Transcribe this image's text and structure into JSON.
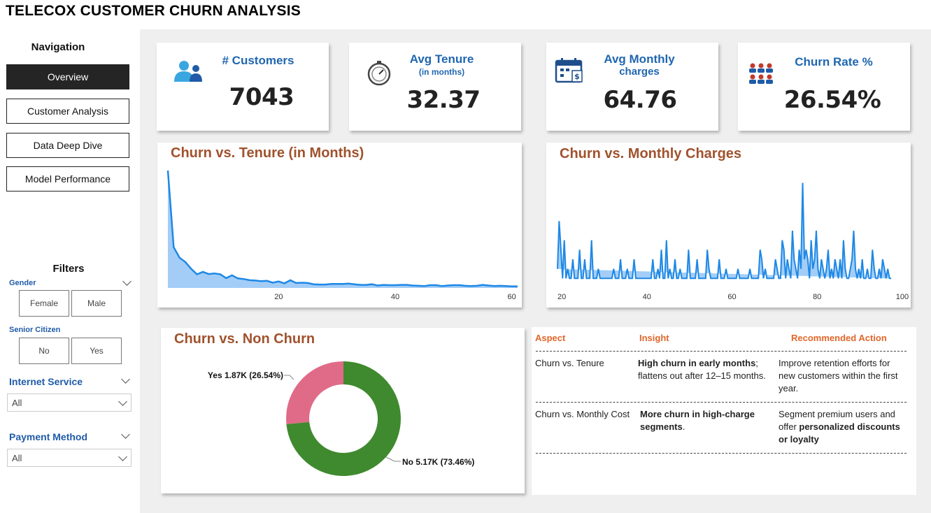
{
  "page": {
    "title": "TELECOX CUSTOMER CHURN ANALYSIS"
  },
  "sidebar": {
    "nav_title": "Navigation",
    "nav_items": [
      {
        "label": "Overview",
        "active": true
      },
      {
        "label": "Customer Analysis",
        "active": false
      },
      {
        "label": "Data Deep Dive",
        "active": false
      },
      {
        "label": "Model Performance",
        "active": false
      }
    ],
    "filters_title": "Filters",
    "gender": {
      "label": "Gender",
      "options": [
        "Female",
        "Male"
      ]
    },
    "senior": {
      "label": "Senior Citizen",
      "options": [
        "No",
        "Yes"
      ]
    },
    "internet": {
      "label": "Internet Service",
      "value": "All"
    },
    "payment": {
      "label": "Payment Method",
      "value": "All"
    }
  },
  "kpis": [
    {
      "label": "# Customers",
      "sub": "",
      "value": "7043",
      "icon": "customers-icon"
    },
    {
      "label": "Avg Tenure",
      "sub": "(in months)",
      "value": "32.37",
      "icon": "stopwatch-icon"
    },
    {
      "label": "Avg Monthly",
      "sub": "charges",
      "value": "64.76",
      "icon": "calendar-dollar-icon"
    },
    {
      "label": "Churn Rate %",
      "sub": "",
      "value": "26.54%",
      "icon": "people-group-icon"
    }
  ],
  "chart_data": [
    {
      "type": "area",
      "title": "Churn vs. Tenure (in Months)",
      "xlabel": "",
      "ylabel": "",
      "xlim": [
        1,
        61
      ],
      "x_ticks": [
        20,
        40,
        60
      ],
      "x": [
        1,
        2,
        3,
        4,
        5,
        6,
        7,
        8,
        9,
        10,
        11,
        12,
        13,
        14,
        15,
        16,
        17,
        18,
        19,
        20,
        21,
        22,
        23,
        24,
        25,
        26,
        27,
        28,
        29,
        30,
        31,
        32,
        33,
        34,
        35,
        36,
        37,
        38,
        39,
        40,
        41,
        42,
        43,
        44,
        45,
        46,
        47,
        48,
        49,
        50,
        51,
        52,
        53,
        54,
        55,
        56,
        57,
        58,
        59,
        60,
        61
      ],
      "values": [
        380,
        132,
        98,
        84,
        62,
        44,
        52,
        45,
        47,
        44,
        32,
        41,
        31,
        29,
        25,
        24,
        22,
        23,
        17,
        21,
        15,
        25,
        16,
        17,
        16,
        12,
        11,
        11,
        13,
        13,
        13,
        14,
        12,
        10,
        10,
        12,
        8,
        10,
        9,
        9,
        10,
        10,
        8,
        7,
        6,
        9,
        9,
        6,
        8,
        9,
        9,
        7,
        6,
        7,
        10,
        8,
        6,
        7,
        6,
        5,
        5
      ],
      "series_color": "#1e88e5",
      "grid": false
    },
    {
      "type": "area",
      "title": "Churn vs. Monthly Charges",
      "xlabel": "",
      "ylabel": "",
      "xlim": [
        19,
        101
      ],
      "x_ticks": [
        20,
        40,
        60,
        80,
        100
      ],
      "x": [
        19.0,
        19.4,
        19.8,
        20.2,
        20.6,
        21.0,
        21.4,
        21.8,
        22.2,
        22.6,
        23.0,
        23.4,
        23.8,
        24.2,
        24.6,
        25.0,
        25.4,
        25.8,
        26.2,
        26.6,
        27.0,
        27.4,
        27.8,
        28.2,
        28.6,
        29.0,
        29.4,
        29.8,
        30.2,
        30.6,
        31.0,
        31.4,
        31.8,
        32.2,
        32.6,
        33.0,
        33.4,
        33.8,
        34.2,
        34.6,
        35.0,
        35.4,
        35.8,
        36.2,
        36.6,
        37.0,
        37.4,
        37.8,
        38.2,
        38.6,
        39.0,
        39.4,
        39.8,
        40.2,
        40.6,
        41.0,
        41.4,
        41.8,
        42.2,
        42.6,
        43.0,
        43.4,
        43.8,
        44.2,
        44.6,
        45.0,
        45.4,
        45.8,
        46.2,
        46.6,
        47.0,
        47.4,
        47.8,
        48.2,
        48.6,
        49.0,
        49.4,
        49.8,
        50.2,
        50.6,
        51.0,
        51.4,
        51.8,
        52.2,
        52.6,
        53.0,
        53.4,
        53.8,
        54.2,
        54.6,
        55.0,
        55.4,
        55.8,
        56.2,
        56.6,
        57.0,
        57.4,
        57.8,
        58.2,
        58.6,
        59.0,
        59.4,
        59.8,
        60.2,
        60.6,
        61.0,
        61.4,
        61.8,
        62.2,
        62.6,
        63.0,
        63.4,
        63.8,
        64.2,
        64.6,
        65.0,
        65.4,
        65.8,
        66.2,
        66.6,
        67.0,
        67.4,
        67.8,
        68.2,
        68.6,
        69.0,
        69.4,
        69.8,
        70.2,
        70.6,
        71.0,
        71.4,
        71.8,
        72.2,
        72.6,
        73.0,
        73.4,
        73.8,
        74.2,
        74.6,
        75.0,
        75.4,
        75.8,
        76.2,
        76.6,
        77.0,
        77.4,
        77.8,
        78.2,
        78.6,
        79.0,
        79.4,
        79.8,
        80.2,
        80.6,
        81.0,
        81.4,
        81.8,
        82.2,
        82.6,
        83.0,
        83.4,
        83.8,
        84.2,
        84.6,
        85.0,
        85.4,
        85.8,
        86.2,
        86.6,
        87.0,
        87.4,
        87.8,
        88.2,
        88.6,
        89.0,
        89.4,
        89.8,
        90.2,
        90.6,
        91.0,
        91.4,
        91.8,
        92.2,
        92.6,
        93.0,
        93.4,
        93.8,
        94.2,
        94.6,
        95.0,
        95.4,
        95.8,
        96.2,
        96.6,
        97.0,
        97.4,
        97.8,
        98.2,
        98.6,
        99.0,
        99.4,
        99.8,
        100.2,
        100.6
      ],
      "values": [
        2,
        7,
        4,
        1,
        5,
        1,
        2,
        1,
        1,
        3,
        1,
        1,
        1,
        4,
        1,
        1,
        3,
        1,
        1,
        1,
        5,
        1,
        1,
        1,
        2,
        1,
        1,
        1,
        1,
        1,
        1,
        1,
        1,
        2,
        1,
        1,
        1,
        3,
        1,
        1,
        1,
        2,
        1,
        1,
        1,
        3,
        1,
        1,
        1,
        1,
        1,
        1,
        1,
        1,
        1,
        1,
        3,
        1,
        1,
        2,
        1,
        4,
        1,
        1,
        5,
        1,
        2,
        1,
        1,
        3,
        1,
        1,
        2,
        1,
        1,
        1,
        1,
        4,
        1,
        1,
        1,
        1,
        3,
        1,
        1,
        1,
        1,
        1,
        4,
        2,
        1,
        1,
        1,
        1,
        1,
        3,
        1,
        1,
        1,
        2,
        1,
        1,
        1,
        1,
        1,
        1,
        2,
        1,
        1,
        1,
        1,
        1,
        1,
        2,
        1,
        1,
        1,
        1,
        1,
        4,
        3,
        1,
        2,
        1,
        1,
        1,
        1,
        1,
        3,
        2,
        1,
        1,
        5,
        4,
        1,
        3,
        2,
        1,
        6,
        3,
        2,
        1,
        4,
        2,
        11,
        3,
        4,
        3,
        1,
        5,
        2,
        3,
        6,
        2,
        1,
        3,
        2,
        1,
        2,
        4,
        1,
        2,
        1,
        3,
        2,
        1,
        3,
        1,
        5,
        2,
        1,
        1,
        2,
        3,
        6,
        2,
        1,
        2,
        1,
        3,
        1,
        1,
        2,
        1,
        1,
        4,
        2,
        1,
        1,
        2,
        1,
        3,
        2,
        1,
        2,
        1,
        1
      ],
      "series_color": "#1e88e5",
      "grid": false
    },
    {
      "type": "pie",
      "title": "Churn vs. Non Churn",
      "labels": [
        "No",
        "Yes"
      ],
      "values": [
        5174,
        1869
      ],
      "data_labels": [
        "No 5.17K (73.46%)",
        "Yes 1.87K (26.54%)"
      ],
      "colors": [
        "#3f8a2e",
        "#e06b88"
      ]
    }
  ],
  "insights": {
    "headers": [
      "Aspect",
      "Insight",
      "Recommended Action"
    ],
    "rows": [
      {
        "aspect": "Churn vs. Tenure",
        "insight_bold": "High churn in early months",
        "insight_rest": "; flattens out after 12–15 months.",
        "action_plain": "Improve retention efforts for new customers within the first year.",
        "action_bold": ""
      },
      {
        "aspect": "Churn vs. Monthly Cost",
        "insight_bold": "More churn in high-charge segments",
        "insight_rest": ".",
        "action_plain": "Segment premium users and offer ",
        "action_bold": "personalized discounts or loyalty"
      }
    ]
  },
  "colors": {
    "accent_blue": "#1f66b0",
    "title_brown": "#a0522d",
    "header_orange": "#e0662a",
    "nav_active": "#252525"
  }
}
